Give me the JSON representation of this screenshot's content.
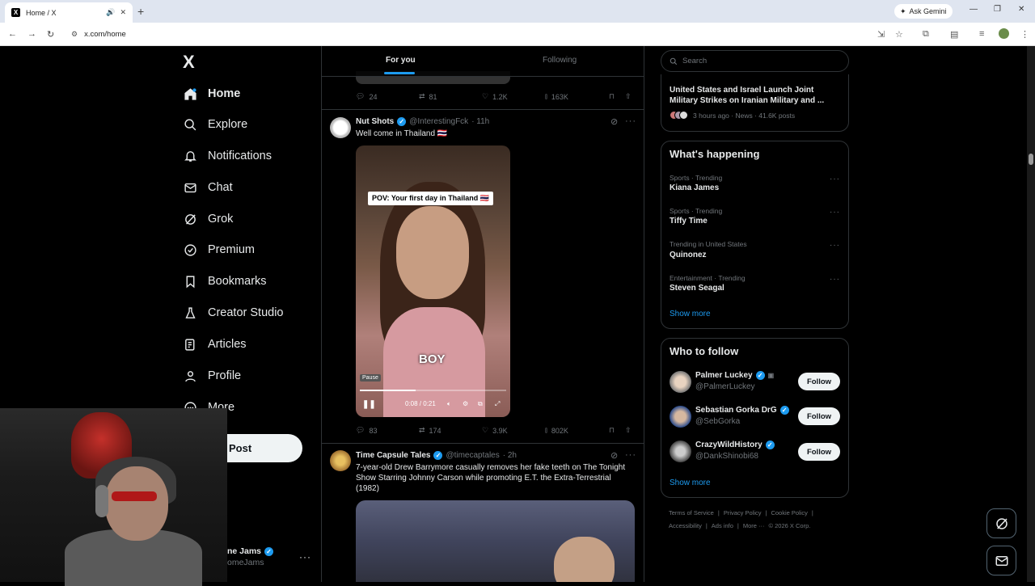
{
  "browser": {
    "tab_title": "Home / X",
    "tab_favicon": "X",
    "ask_gemini": "Ask Gemini",
    "url": "x.com/home"
  },
  "sidebar": {
    "logo": "X",
    "items": [
      {
        "label": "Home",
        "icon": "home-icon"
      },
      {
        "label": "Explore",
        "icon": "search-icon"
      },
      {
        "label": "Notifications",
        "icon": "bell-icon"
      },
      {
        "label": "Chat",
        "icon": "mail-icon"
      },
      {
        "label": "Grok",
        "icon": "grok-icon"
      },
      {
        "label": "Premium",
        "icon": "premium-icon"
      },
      {
        "label": "Bookmarks",
        "icon": "bookmark-icon"
      },
      {
        "label": "Creator Studio",
        "icon": "flask-icon"
      },
      {
        "label": "Articles",
        "icon": "articles-icon"
      },
      {
        "label": "Profile",
        "icon": "person-icon"
      },
      {
        "label": "More",
        "icon": "more-circle-icon"
      }
    ],
    "post_button": "Post",
    "account_name": "ne Jams",
    "account_handle": "omeJams"
  },
  "feed": {
    "tabs": [
      "For you",
      "Following"
    ],
    "prev_tweet_stats": {
      "replies": "24",
      "reposts": "81",
      "likes": "1.2K",
      "views": "163K"
    },
    "tweet1": {
      "name": "Nut Shots",
      "handle": "@InterestingFck",
      "time": "· 11h",
      "text": "Well come in Thailand 🇹🇭",
      "video": {
        "caption_top": "POV: Your first day in Thailand 🇹🇭",
        "caption_bottom": "BOY",
        "tooltip": "Pause",
        "time": "0:08 / 0:21",
        "progress": 0.38
      },
      "stats": {
        "replies": "83",
        "reposts": "174",
        "likes": "3.9K",
        "views": "802K"
      }
    },
    "tweet2": {
      "name": "Time Capsule Tales",
      "handle": "@timecaptales",
      "time": "· 2h",
      "text": "7-year-old Drew Barrymore casually removes her fake teeth on The Tonight Show Starring Johnny Carson while promoting E.T. the Extra-Terrestrial (1982)"
    }
  },
  "right": {
    "search_placeholder": "Search",
    "news": {
      "title": "United States and Israel Launch Joint Military Strikes on Iranian Military and ...",
      "meta": "3 hours ago · News · 41.6K posts"
    },
    "whats_happening": {
      "title": "What's happening",
      "trends": [
        {
          "category": "Sports · Trending",
          "name": "Kiana James"
        },
        {
          "category": "Sports · Trending",
          "name": "Tiffy Time"
        },
        {
          "category": "Trending in United States",
          "name": "Quinonez"
        },
        {
          "category": "Entertainment · Trending",
          "name": "Steven Seagal"
        }
      ],
      "show_more": "Show more"
    },
    "who_to_follow": {
      "title": "Who to follow",
      "accounts": [
        {
          "name": "Palmer Luckey",
          "handle": "@PalmerLuckey",
          "button": "Follow"
        },
        {
          "name": "Sebastian Gorka DrG",
          "handle": "@SebGorka",
          "button": "Follow"
        },
        {
          "name": "CrazyWildHistory",
          "handle": "@DankShinobi68",
          "button": "Follow"
        }
      ],
      "show_more": "Show more"
    },
    "footer": {
      "links": [
        "Terms of Service",
        "Privacy Policy",
        "Cookie Policy",
        "Accessibility",
        "Ads info",
        "More ···"
      ],
      "copyright": "© 2026 X Corp."
    }
  },
  "colors": {
    "accent": "#1d9bf0",
    "background": "#000000",
    "border": "#2f3336"
  }
}
